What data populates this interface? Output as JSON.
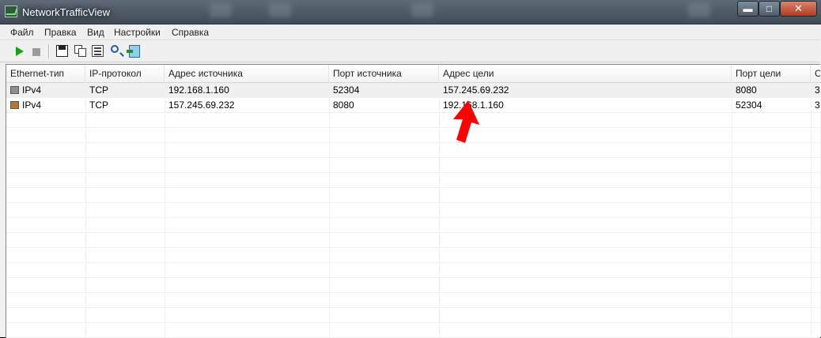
{
  "window": {
    "title": "NetworkTrafficView"
  },
  "title_controls": {
    "minimize": "▬",
    "maximize": "□",
    "close": "✕"
  },
  "menu": [
    "Файл",
    "Правка",
    "Вид",
    "Настройки",
    "Справка"
  ],
  "toolbar": {
    "icons": [
      "start-capture-icon",
      "stop-capture-icon",
      "save-icon",
      "copy-icon",
      "properties-icon",
      "find-icon",
      "exit-icon"
    ]
  },
  "table": {
    "columns": [
      "Ethernet-тип",
      "IP-протокол",
      "Адрес источника",
      "Порт источника",
      "Адрес цели",
      "Порт цели",
      "С"
    ],
    "rows": [
      {
        "ethernet_type": "IPv4",
        "ip_protocol": "TCP",
        "src_address": "192.168.1.160",
        "src_port": "52304",
        "dst_address": "157.245.69.232",
        "dst_port": "8080",
        "extra": "3",
        "icon_color": "#8f8f8f"
      },
      {
        "ethernet_type": "IPv4",
        "ip_protocol": "TCP",
        "src_address": "157.245.69.232",
        "src_port": "8080",
        "dst_address": "192.168.1.160",
        "dst_port": "52304",
        "extra": "3",
        "icon_color": "#b07a3a"
      }
    ]
  },
  "annotation": {
    "arrow_color": "#ff0000"
  }
}
